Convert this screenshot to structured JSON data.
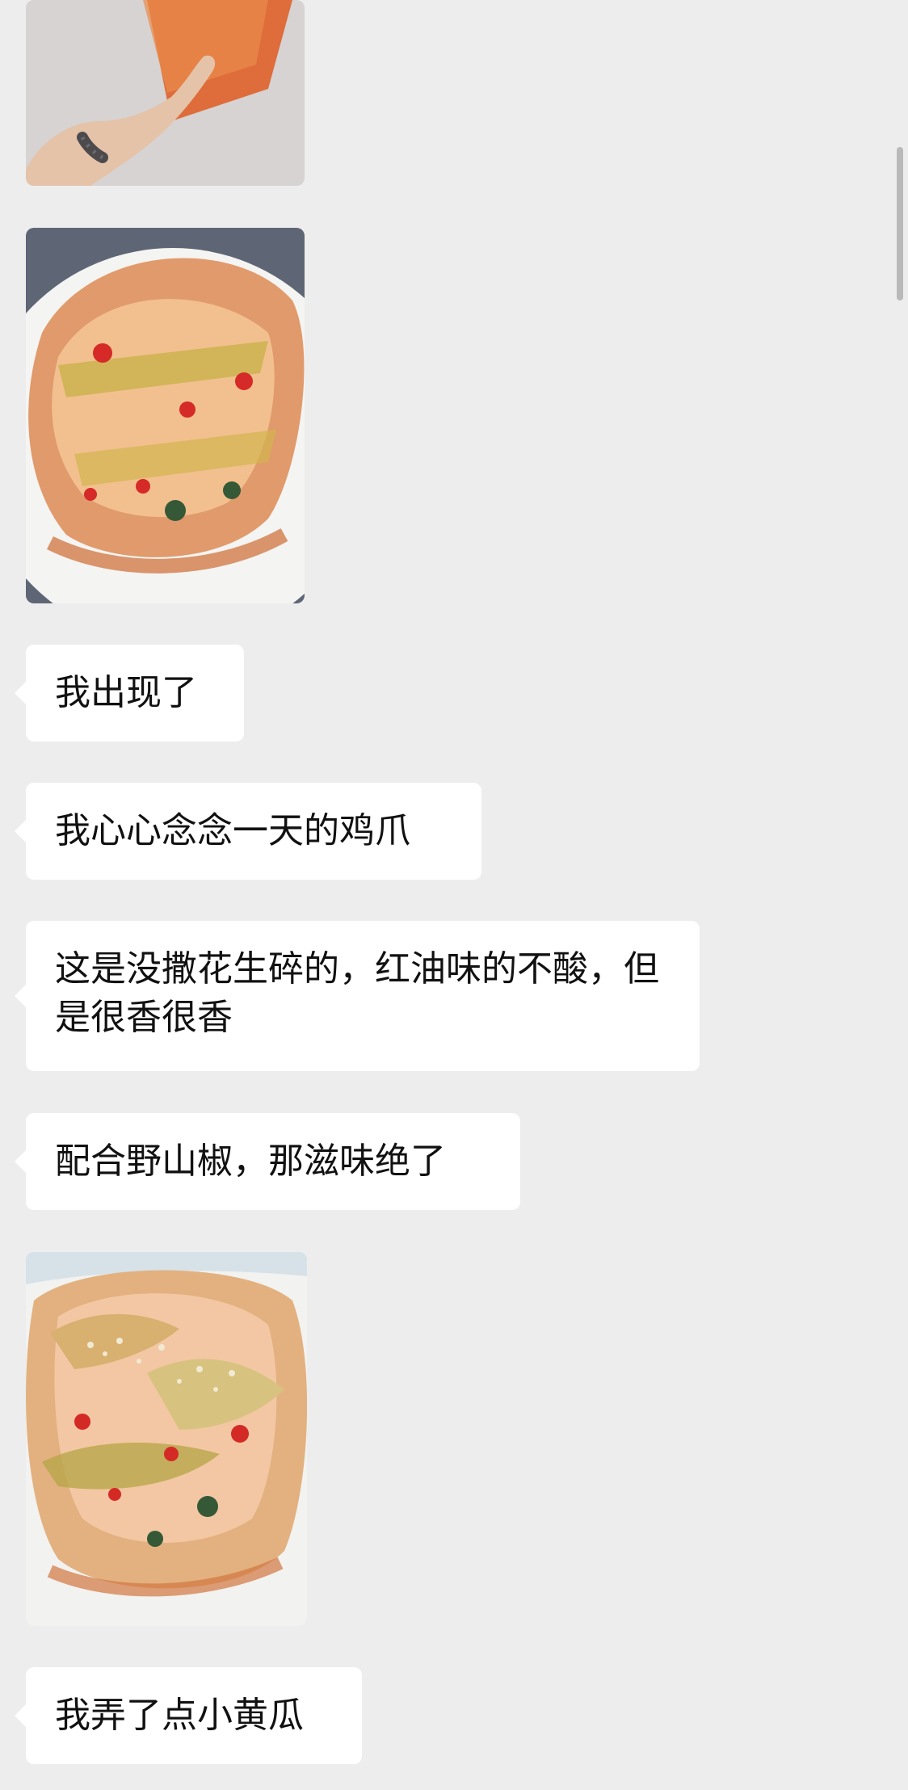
{
  "messages": [
    {
      "type": "image",
      "content": "hand-holding-bag-photo"
    },
    {
      "type": "image",
      "content": "chicken-feet-dish-photo"
    },
    {
      "type": "text",
      "text": "我出现了"
    },
    {
      "type": "text",
      "text": "我心心念念一天的鸡爪"
    },
    {
      "type": "text",
      "text": "这是没撒花生碎的，红油味的不酸，但是很香很香"
    },
    {
      "type": "text",
      "text": "配合野山椒，那滋味绝了"
    },
    {
      "type": "image",
      "content": "chicken-feet-with-peanuts-photo"
    },
    {
      "type": "text",
      "text": "我弄了点小黄瓜"
    }
  ],
  "colors": {
    "background": "#ededed",
    "bubble": "#ffffff",
    "text": "#111111",
    "scrollbar": "#b9b9b9"
  }
}
